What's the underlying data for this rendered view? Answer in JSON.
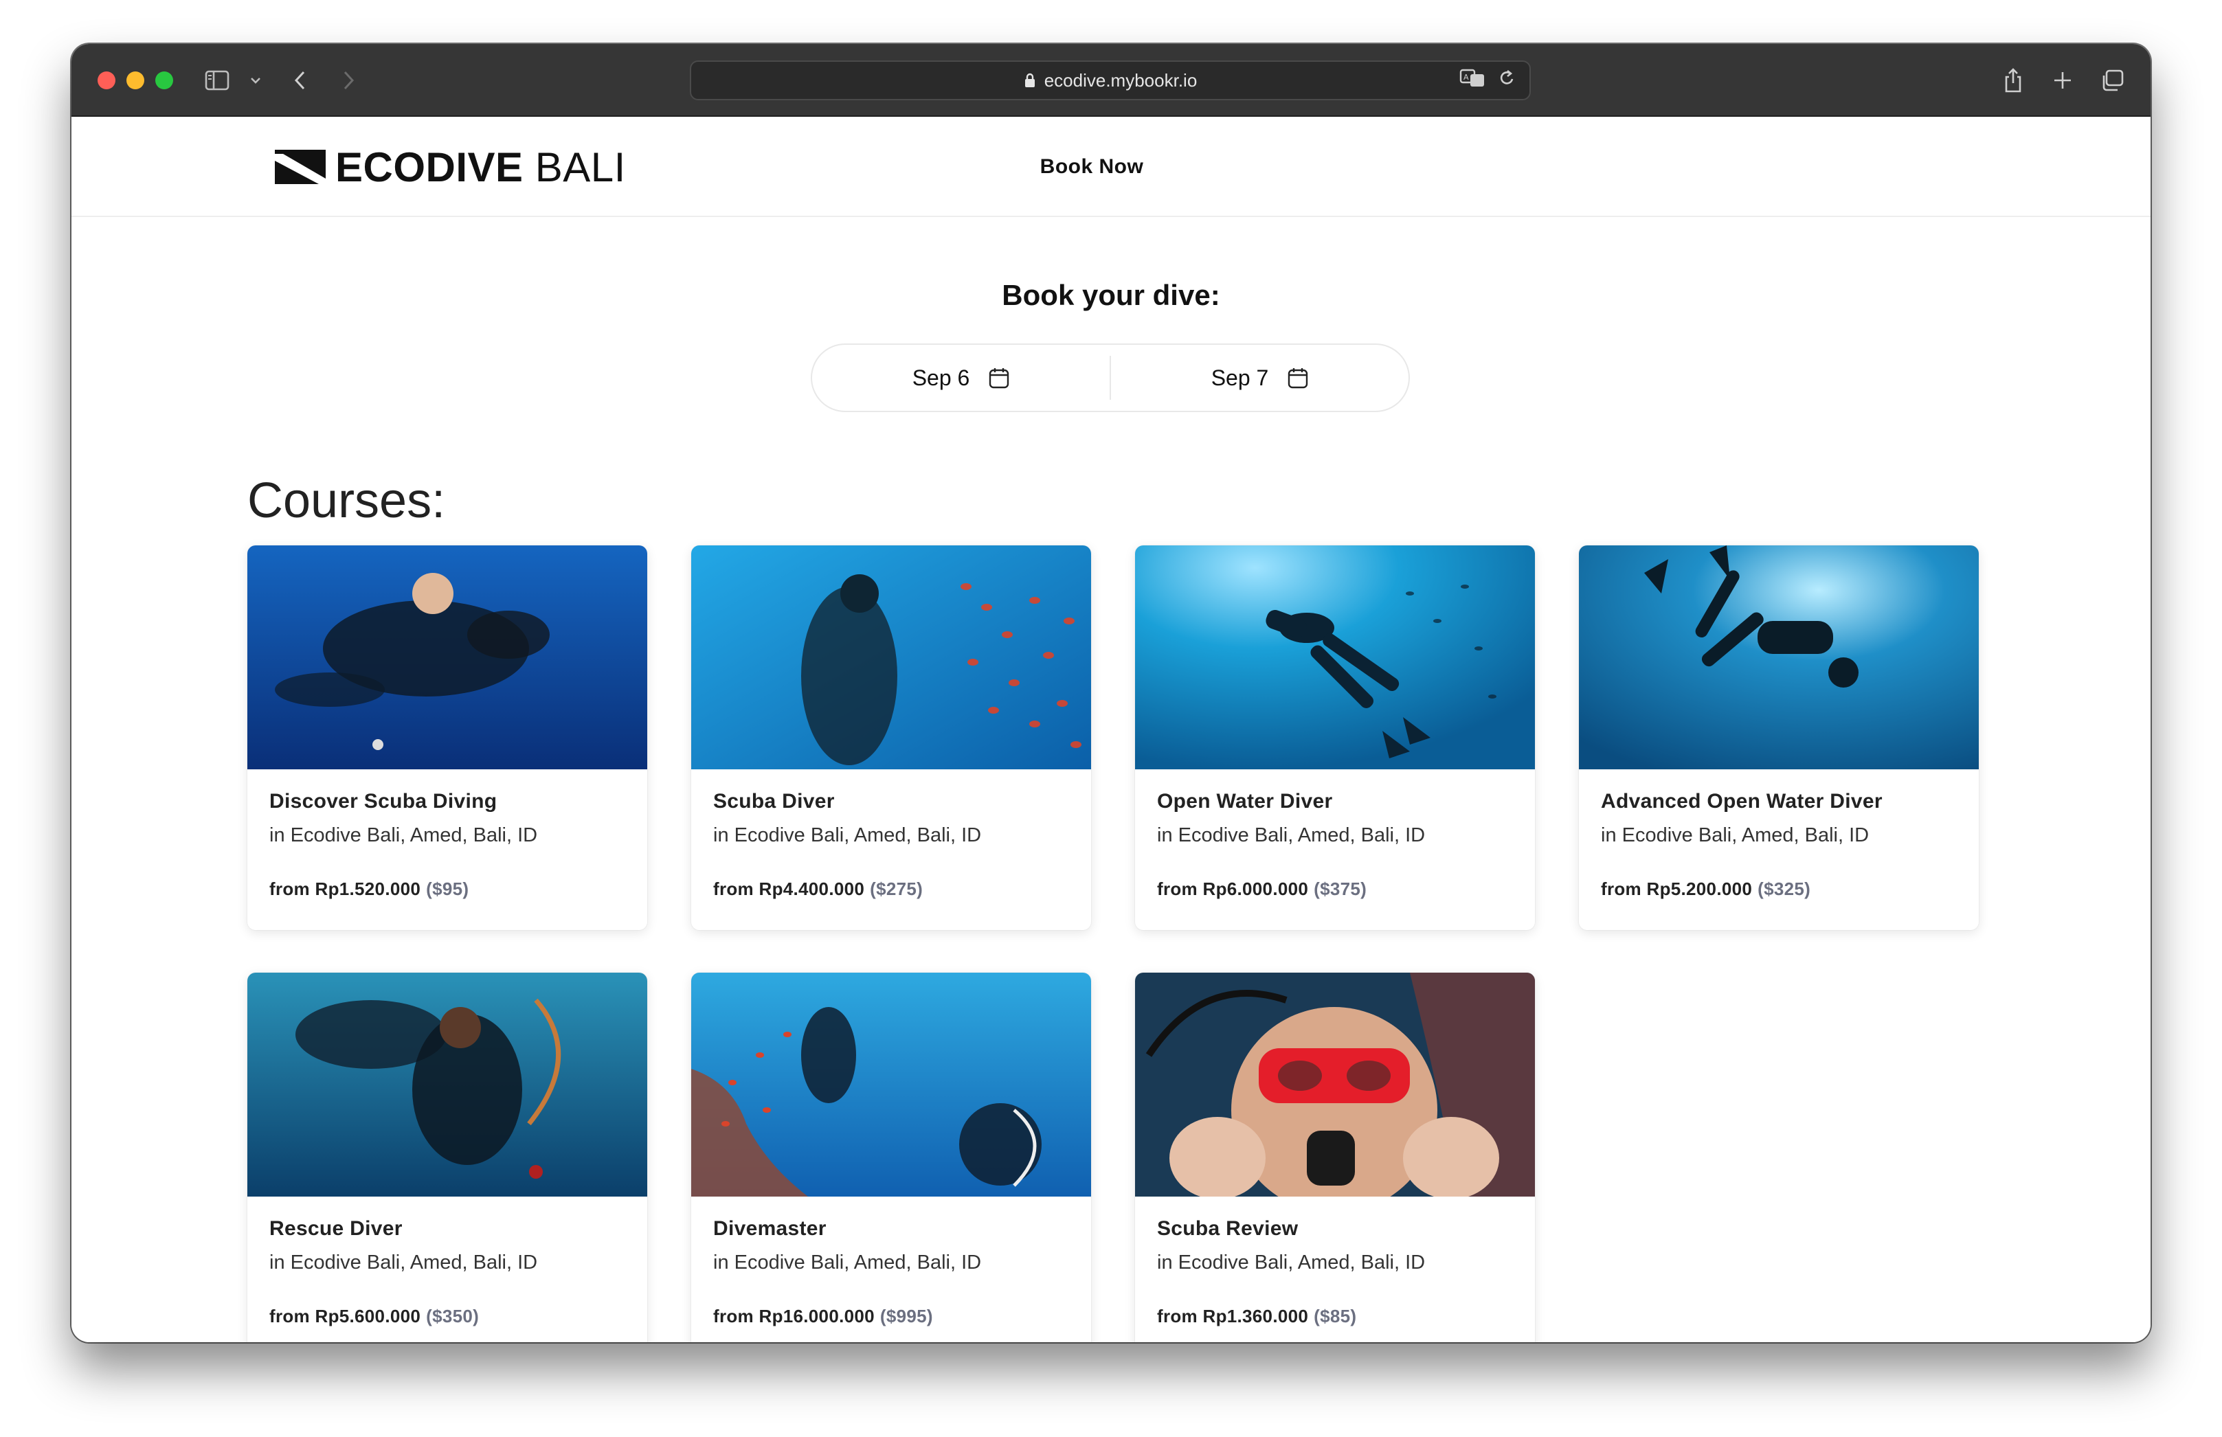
{
  "browser": {
    "url": "ecodive.mybookr.io"
  },
  "header": {
    "logo_bold": "ECODIVE",
    "logo_light": "BALI",
    "nav_book": "Book Now"
  },
  "booking": {
    "title": "Book your dive:",
    "start_date": "Sep 6",
    "end_date": "Sep 7"
  },
  "courses": {
    "title": "Courses:",
    "items": [
      {
        "name": "Discover Scuba Diving",
        "location": "in Ecodive Bali, Amed, Bali, ID",
        "price": "from Rp1.520.000",
        "usd": "($95)"
      },
      {
        "name": "Scuba Diver",
        "location": "in Ecodive Bali, Amed, Bali, ID",
        "price": "from Rp4.400.000",
        "usd": "($275)"
      },
      {
        "name": "Open Water Diver",
        "location": "in Ecodive Bali, Amed, Bali, ID",
        "price": "from Rp6.000.000",
        "usd": "($375)"
      },
      {
        "name": "Advanced Open Water Diver",
        "location": "in Ecodive Bali, Amed, Bali, ID",
        "price": "from Rp5.200.000",
        "usd": "($325)"
      },
      {
        "name": "Rescue Diver",
        "location": "in Ecodive Bali, Amed, Bali, ID",
        "price": "from Rp5.600.000",
        "usd": "($350)"
      },
      {
        "name": "Divemaster",
        "location": "in Ecodive Bali, Amed, Bali, ID",
        "price": "from Rp16.000.000",
        "usd": "($995)"
      },
      {
        "name": "Scuba Review",
        "location": "in Ecodive Bali, Amed, Bali, ID",
        "price": "from Rp1.360.000",
        "usd": "($85)"
      }
    ]
  },
  "colors": {
    "titlebar": "#363636",
    "ocean_deep": "#0a3f8a",
    "ocean_light": "#1fa3e0",
    "price_usd": "#6b6f80"
  }
}
